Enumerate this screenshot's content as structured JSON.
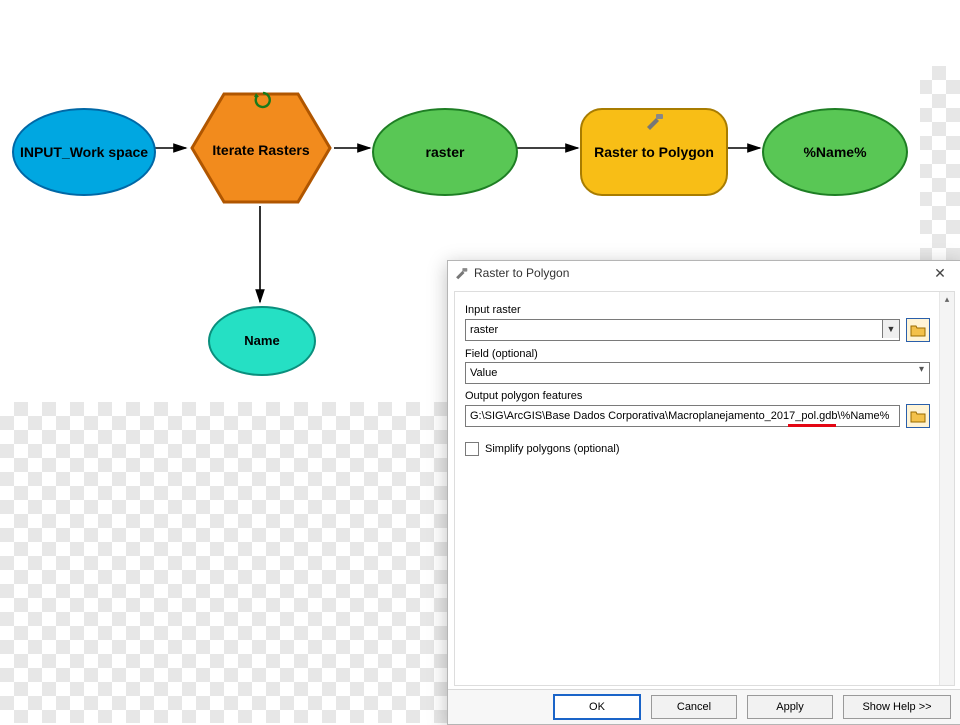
{
  "model": {
    "input_ws": "INPUT_Work space",
    "iterator": "Iterate Rasters",
    "raster": "raster",
    "tool": "Raster to Polygon",
    "out_var": "%Name%",
    "name_var": "Name"
  },
  "dialog": {
    "title": "Raster to Polygon",
    "labels": {
      "input_raster": "Input raster",
      "field": "Field (optional)",
      "output": "Output polygon features",
      "simplify": "Simplify polygons (optional)"
    },
    "values": {
      "input_raster": "raster",
      "field": "Value",
      "output": "G:\\SIG\\ArcGIS\\Base Dados Corporativa\\Macroplanejamento_2017_pol.gdb\\%Name%"
    },
    "buttons": {
      "ok": "OK",
      "cancel": "Cancel",
      "apply": "Apply",
      "help": "Show Help >>"
    }
  }
}
